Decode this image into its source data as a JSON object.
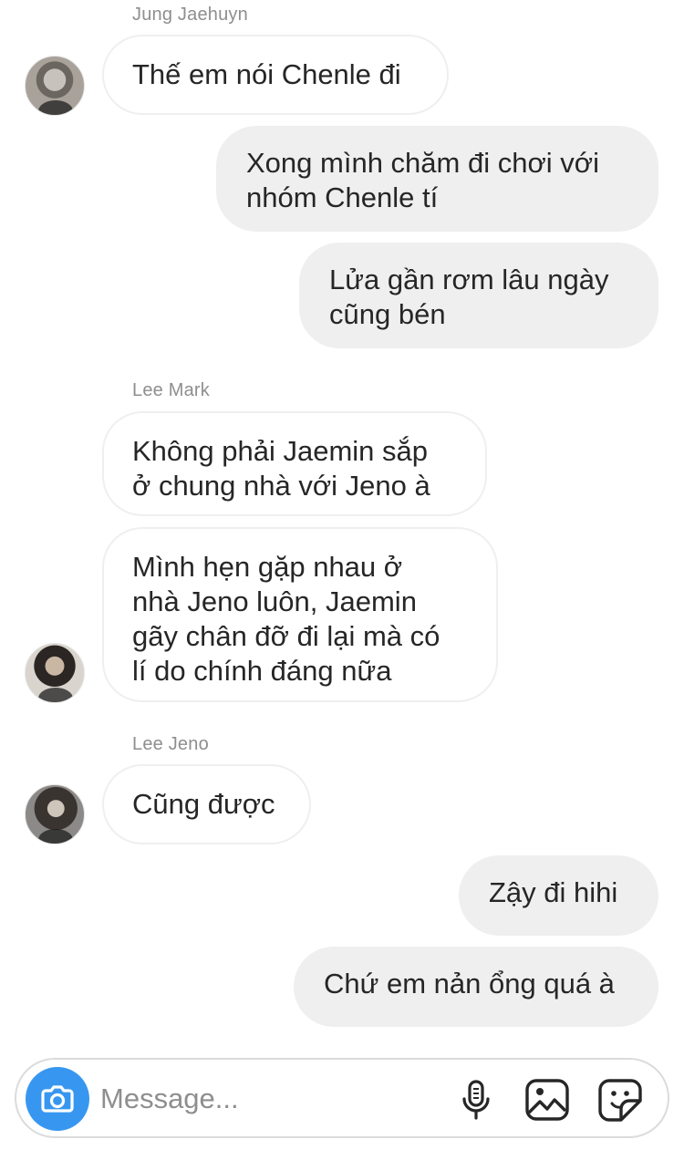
{
  "colors": {
    "accent": "#3797f0",
    "bubble_out_bg": "#efefef",
    "bubble_in_border": "#efefef",
    "sender_name": "#8e8e8e",
    "text": "#262626"
  },
  "thread": {
    "senders": {
      "jaehyun": "Jung Jaehuyn",
      "mark": "Lee Mark",
      "jeno": "Lee Jeno"
    },
    "messages": [
      {
        "from": "Jung Jaehuyn",
        "direction": "incoming",
        "text": "Thế em nói Chenle đi"
      },
      {
        "from": "me",
        "direction": "outgoing",
        "text": "Xong mình chăm đi chơi với\nnhóm Chenle tí"
      },
      {
        "from": "me",
        "direction": "outgoing",
        "text": "Lửa gần rơm lâu ngày\ncũng bén"
      },
      {
        "from": "Lee Mark",
        "direction": "incoming",
        "text": "Không phải Jaemin sắp\nở chung nhà với Jeno à"
      },
      {
        "from": "Lee Mark",
        "direction": "incoming",
        "text": "Mình hẹn gặp nhau ở\nnhà Jeno luôn, Jaemin\ngãy chân đỡ đi lại mà có\nlí do chính đáng nữa"
      },
      {
        "from": "Lee Jeno",
        "direction": "incoming",
        "text": "Cũng được"
      },
      {
        "from": "me",
        "direction": "outgoing",
        "text": "Zậy đi hihi"
      },
      {
        "from": "me",
        "direction": "outgoing",
        "text": "Chứ em nản ổng quá à"
      }
    ]
  },
  "composer": {
    "placeholder": "Message...",
    "value": "",
    "icons": {
      "camera": "camera-icon",
      "mic": "microphone-icon",
      "gallery": "gallery-icon",
      "sticker": "sticker-icon"
    }
  }
}
